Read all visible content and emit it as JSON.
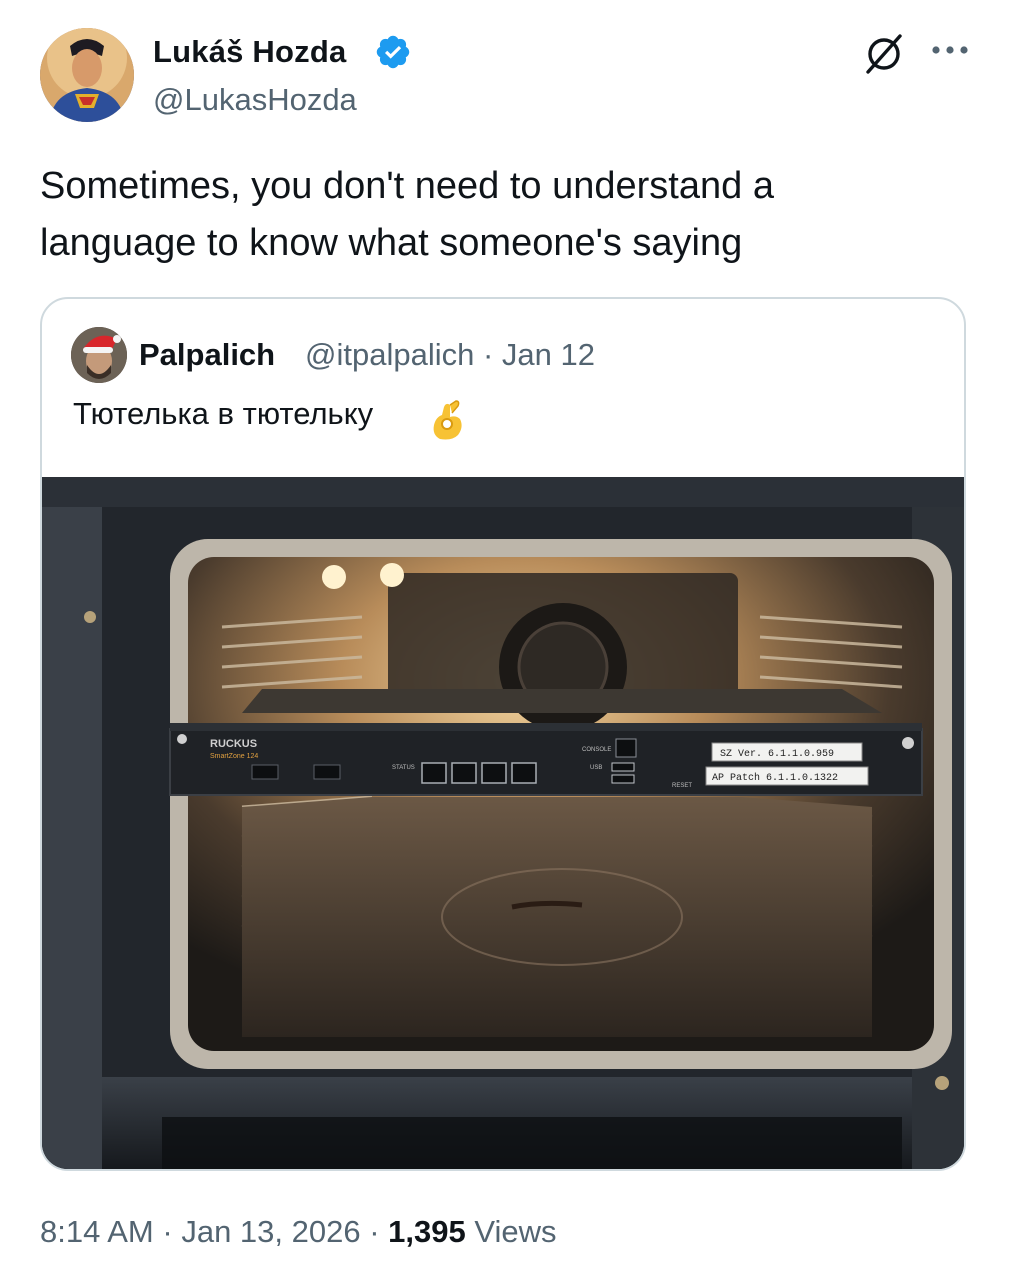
{
  "author": {
    "name": "Lukáš Hozda",
    "handle": "@LukasHozda",
    "verified": true,
    "avatar_icon": "superman-avatar"
  },
  "tweet": {
    "text_line1": "Sometimes, you don't need to understand a",
    "text_line2": "language to know what someone's saying"
  },
  "quoted": {
    "name": "Palpalich",
    "handle": "@itpalpalich",
    "separator": "·",
    "date": "Jan 12",
    "text": "Тютелька в тютельку",
    "emoji": "ok-hand-emoji",
    "photo": {
      "brand": "RUCKUS",
      "model": "SmartZone 124",
      "label_1": "SZ Ver. 6.1.1.0.959",
      "label_2": "AP Patch 6.1.1.0.1322",
      "port_label_console": "CONSOLE",
      "port_label_status": "STATUS",
      "port_label_usb": "USB",
      "port_label_reset": "RESET"
    }
  },
  "footer": {
    "time": "8:14 AM",
    "dot1": "·",
    "date": "Jan 13, 2026",
    "dot2": "·",
    "views_count": "1,395",
    "views_label": "Views"
  },
  "colors": {
    "text": "#0f1419",
    "secondary": "#536471",
    "verified": "#1d9bf0",
    "border": "#cfd9de"
  }
}
